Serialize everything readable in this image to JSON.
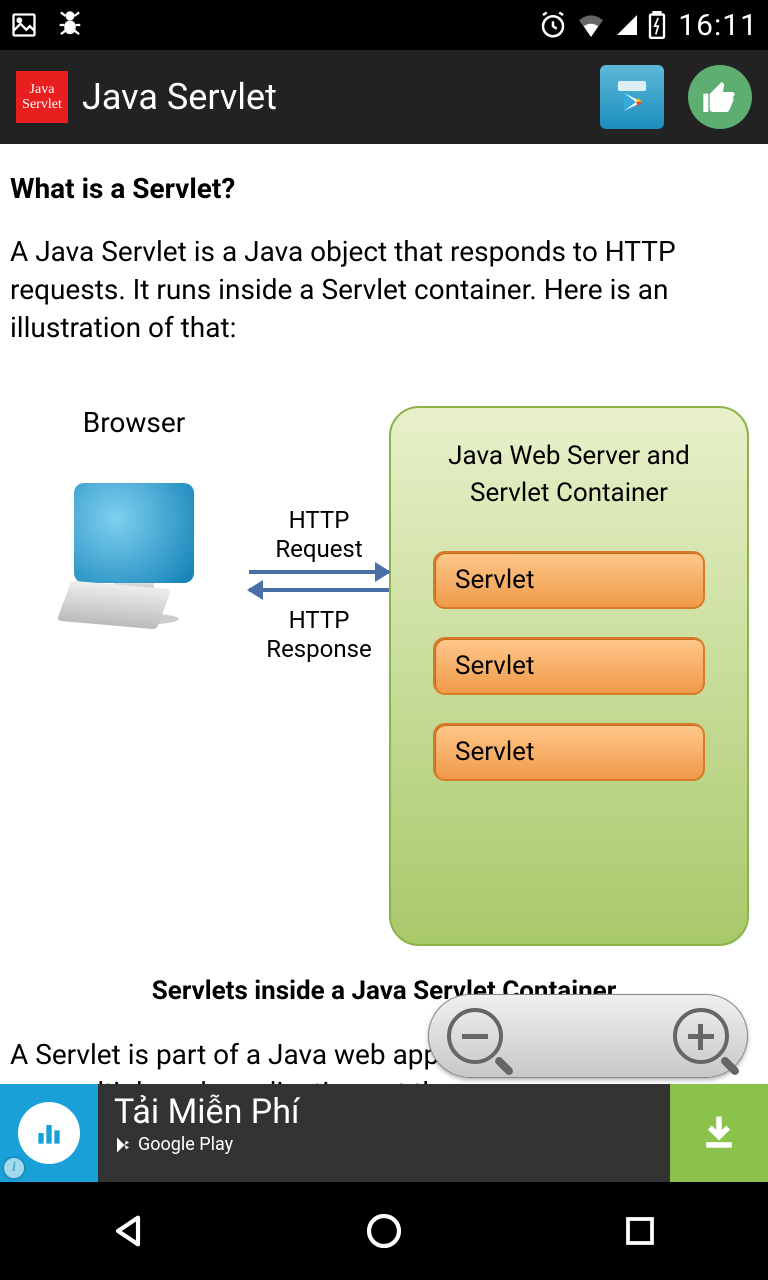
{
  "status": {
    "time": "16:11"
  },
  "appbar": {
    "icon_line1": "Java",
    "icon_line2": "Servlet",
    "title": "Java Servlet"
  },
  "content": {
    "heading": "What is a Servlet?",
    "intro": "A Java Servlet is a Java object that responds to HTTP requests. It runs inside a Servlet container. Here is an illustration of that:",
    "diagram": {
      "browser_label": "Browser",
      "request_label_1": "HTTP",
      "request_label_2": "Request",
      "response_label_1": "HTTP",
      "response_label_2": "Response",
      "server_title_1": "Java Web Server and",
      "server_title_2": "Servlet Container",
      "servlet_label": "Servlet"
    },
    "caption": "Servlets inside a Java Servlet Container",
    "body": "A Servlet is part of a Java web application container may run multiple web applications at the"
  },
  "ad": {
    "title": "Tải Miễn Phí",
    "store": "Google Play"
  }
}
